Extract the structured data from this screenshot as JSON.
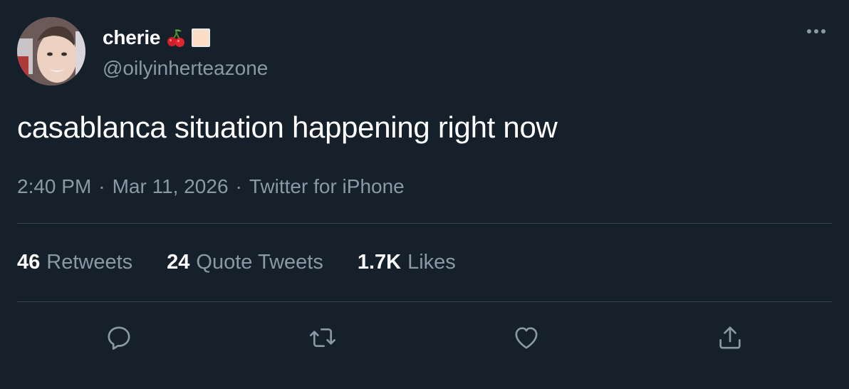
{
  "author": {
    "display_name": "cherie",
    "handle": "@oilyinherteazone",
    "name_emojis": [
      "cherries-icon",
      "peach-square-icon"
    ]
  },
  "tweet": {
    "text": "casablanca situation happening right now",
    "time": "2:40 PM",
    "date": "Mar 11, 2026",
    "source": "Twitter for iPhone",
    "separator": "·"
  },
  "stats": {
    "retweets": {
      "count": "46",
      "label": "Retweets"
    },
    "quote_tweets": {
      "count": "24",
      "label": "Quote Tweets"
    },
    "likes": {
      "count": "1.7K",
      "label": "Likes"
    }
  },
  "actions": [
    "reply-icon",
    "retweet-icon",
    "like-icon",
    "share-icon"
  ],
  "colors": {
    "background": "#15202b",
    "primary_text": "#ffffff",
    "secondary_text": "#8b98a5",
    "divider": "#38444d"
  }
}
